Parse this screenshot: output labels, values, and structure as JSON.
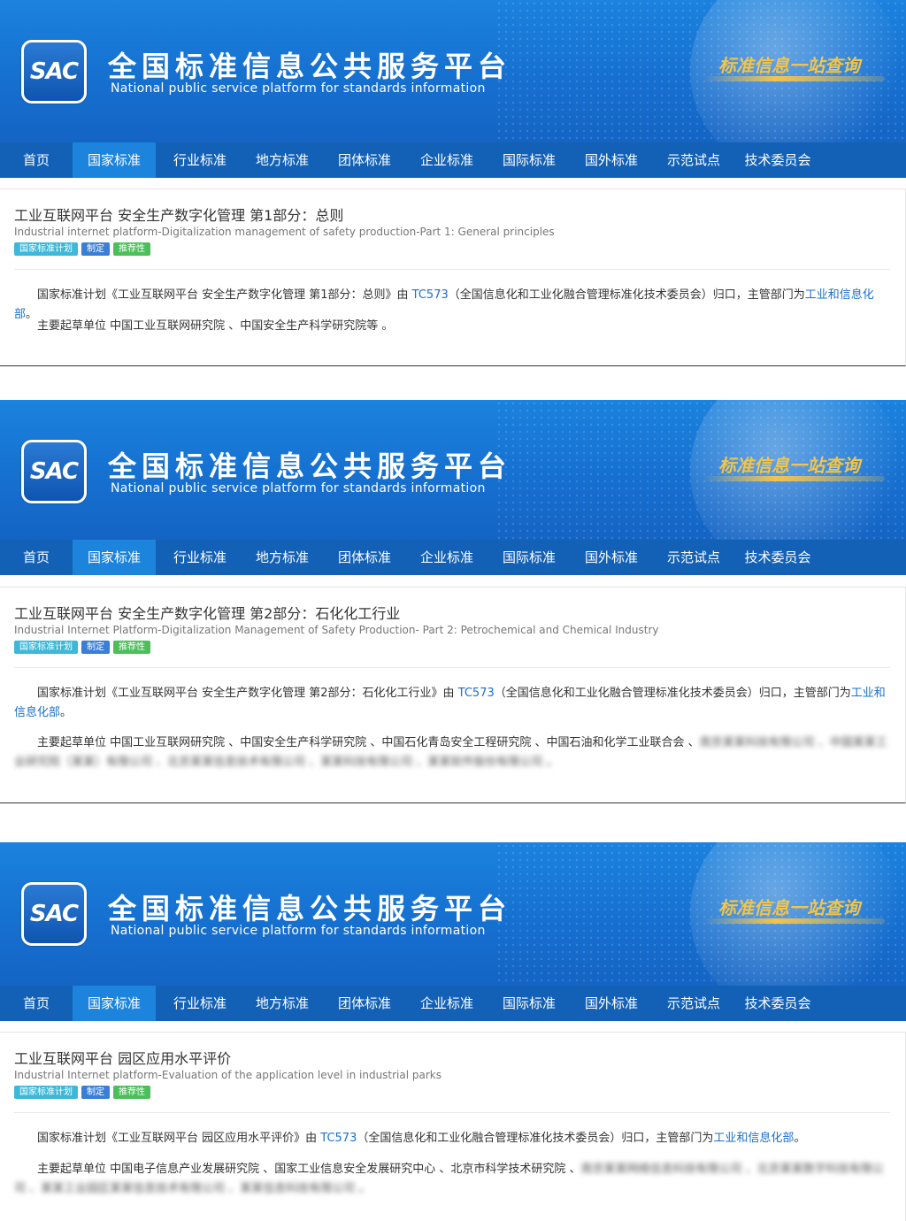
{
  "site": {
    "logo_text": "SAC",
    "title": "全国标准信息公共服务平台",
    "subtitle": "National public service platform  for standards information",
    "slogan": "标准信息一站查询"
  },
  "nav": {
    "items": [
      "首页",
      "国家标准",
      "行业标准",
      "地方标准",
      "团体标准",
      "企业标准",
      "国际标准",
      "国外标准",
      "示范试点",
      "技术委员会"
    ],
    "active_index": 1
  },
  "badges": {
    "plan": "国家标准计划",
    "make": "制定",
    "rec": "推荐性"
  },
  "records": [
    {
      "title_cn": "工业互联网平台 安全生产数字化管理 第1部分：总则",
      "title_en": "Industrial internet platform-Digitalization management of safety production-Part 1: General principles",
      "desc_prefix": "国家标准计划《工业互联网平台 安全生产数字化管理 第1部分：总则》由 ",
      "tc_link": "TC573",
      "desc_middle": "（全国信息化和工业化融合管理标准化技术委员会）归口，主管部门为",
      "dept_link": "工业和信息化部",
      "desc_suffix": "。",
      "drafters": "主要起草单位 中国工业互联网研究院 、中国安全生产科学研究院等 。",
      "drafters_blurred": ""
    },
    {
      "title_cn": "工业互联网平台 安全生产数字化管理 第2部分：石化化工行业",
      "title_en": "Industrial Internet Platform-Digitalization Management of Safety Production- Part 2: Petrochemical and Chemical Industry",
      "desc_prefix": "国家标准计划《工业互联网平台 安全生产数字化管理 第2部分：石化化工行业》由 ",
      "tc_link": "TC573",
      "desc_middle": "（全国信息化和工业化融合管理标准化技术委员会）归口，主管部门为",
      "dept_link": "工业和信息化部",
      "desc_suffix": "。",
      "drafters": "主要起草单位 中国工业互联网研究院 、中国安全生产科学研究院 、中国石化青岛安全工程研究院 、中国石油和化学工业联合会 、",
      "drafters_blurred": "南京某某科技有限公司 、中国某某工业研究院（某某）有限公司 、北京某某信息技术有限公司 、某某科技有限公司 、某某软件股份有限公司 。"
    },
    {
      "title_cn": "工业互联网平台 园区应用水平评价",
      "title_en": "Industrial Internet platform-Evaluation of the application level in industrial parks",
      "desc_prefix": "国家标准计划《工业互联网平台 园区应用水平评价》由 ",
      "tc_link": "TC573",
      "desc_middle": "（全国信息化和工业化融合管理标准化技术委员会）归口，主管部门为",
      "dept_link": "工业和信息化部",
      "desc_suffix": "。",
      "drafters": "主要起草单位 中国电子信息产业发展研究院 、国家工业信息安全发展研究中心 、北京市科学技术研究院 、",
      "drafters_blurred": "南京某某网络信息科技有限公司 、北京某某数字科技有限公司 、某某工业园区某某信息技术有限公司 、某某信息科技有限公司 。"
    }
  ]
}
